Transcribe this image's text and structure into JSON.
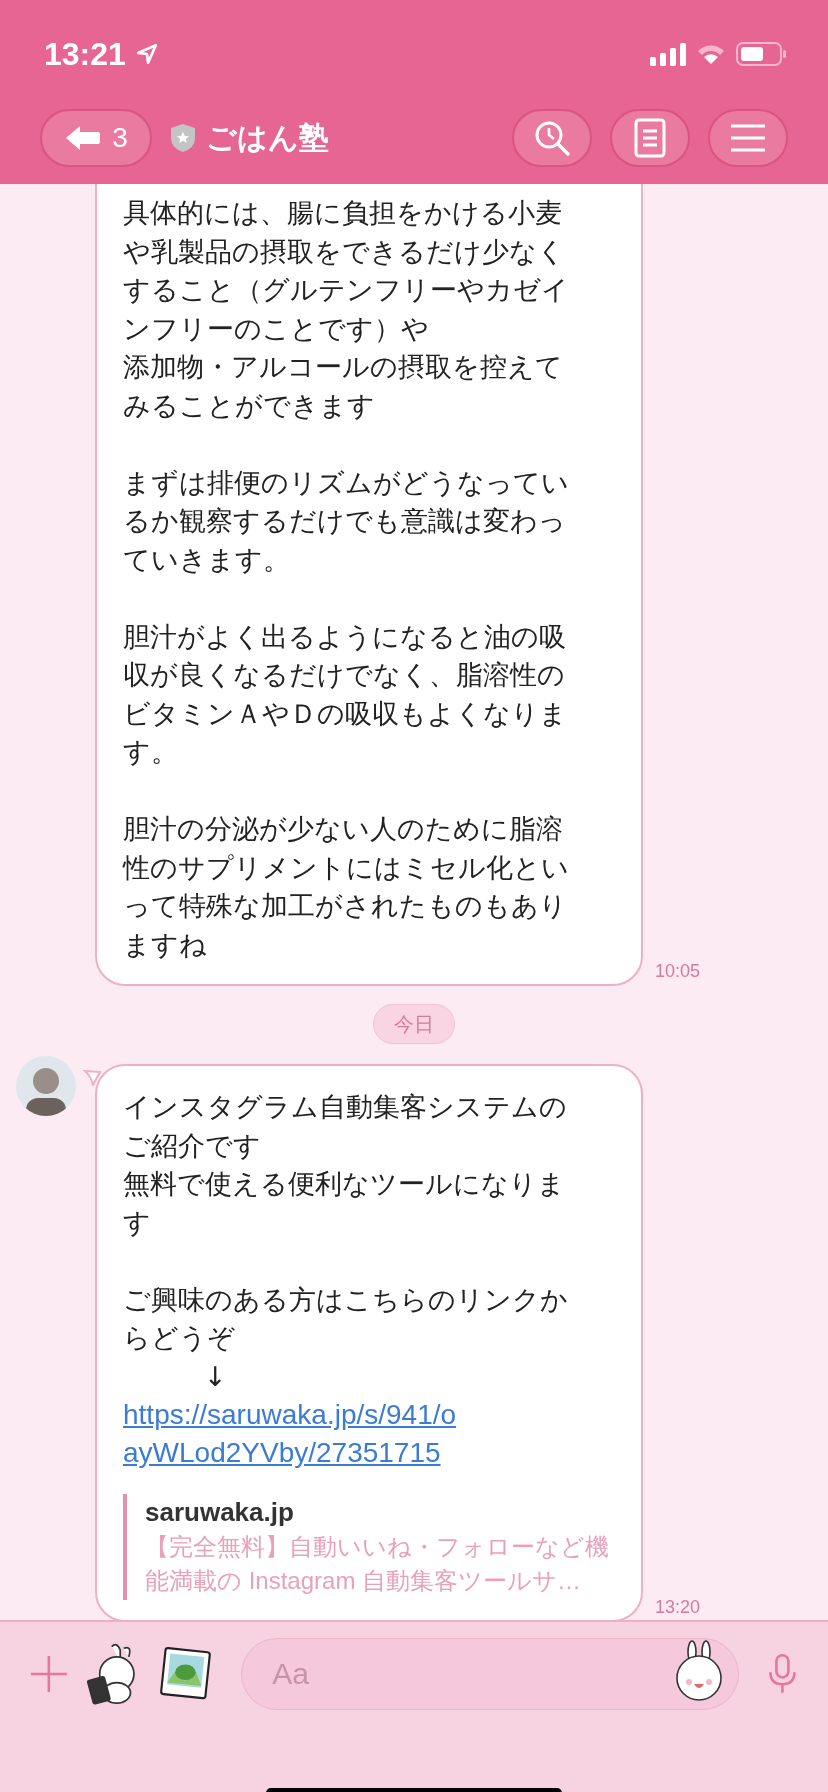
{
  "status_bar": {
    "time": "13:21"
  },
  "header": {
    "back_count": "3",
    "title": "ごはん塾"
  },
  "messages": [
    {
      "kind": "text",
      "avatar": false,
      "paragraphs": [
        [
          "具体的には、腸に負担をかける小麦や乳製品の摂取をできるだけ少なくすること（グルテンフリーやカゼインフリーのことです）や",
          "添加物・アルコールの摂取を控えてみることができます"
        ],
        [
          "まずは排便のリズムがどうなっているか観察するだけでも意識は変わっていきます。"
        ],
        [
          "胆汁がよく出るようになると油の吸収が良くなるだけでなく、脂溶性のビタミンＡやＤの吸収もよくなります。"
        ],
        [
          "胆汁の分泌が少ない人のために脂溶性のサプリメントにはミセル化といって特殊な加工がされたものもありますね"
        ]
      ],
      "time": "10:05"
    },
    {
      "kind": "date",
      "label": "今日"
    },
    {
      "kind": "link",
      "avatar": true,
      "paragraphs": [
        [
          "インスタグラム自動集客システムのご紹介です",
          "無料で使える便利なツールになります"
        ],
        [
          "ご興味のある方はこちらのリンクからどうぞ",
          "　　　↓"
        ]
      ],
      "link": "https://saruwaka.jp/s/941/oayWLod2YVby/27351715",
      "preview": {
        "site": "saruwaka.jp",
        "description": "【完全無料】自動いいね・フォローなど機能満載の Instagram 自動集客ツールサ…"
      },
      "time": "13:20"
    }
  ],
  "composer": {
    "placeholder": "Aa"
  }
}
